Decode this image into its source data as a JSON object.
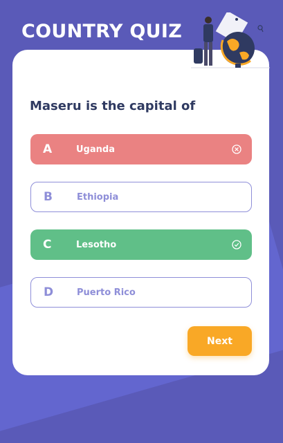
{
  "app": {
    "title": "COUNTRY QUIZ"
  },
  "quiz": {
    "question": "Maseru is the capital of",
    "options": [
      {
        "letter": "A",
        "text": "Uganda",
        "state": "wrong",
        "status_icon": "x-circle-icon"
      },
      {
        "letter": "B",
        "text": "Ethiopia",
        "state": "neutral"
      },
      {
        "letter": "C",
        "text": "Lesotho",
        "state": "correct",
        "status_icon": "check-circle-icon"
      },
      {
        "letter": "D",
        "text": "Puerto Rico",
        "state": "neutral"
      }
    ],
    "next_label": "Next"
  },
  "colors": {
    "background": "#5a5ab8",
    "wrong": "#ea8282",
    "correct": "#60bf88",
    "neutral_border": "#8e8ed8",
    "next_button": "#f9a826",
    "question_text": "#2f3a61"
  }
}
